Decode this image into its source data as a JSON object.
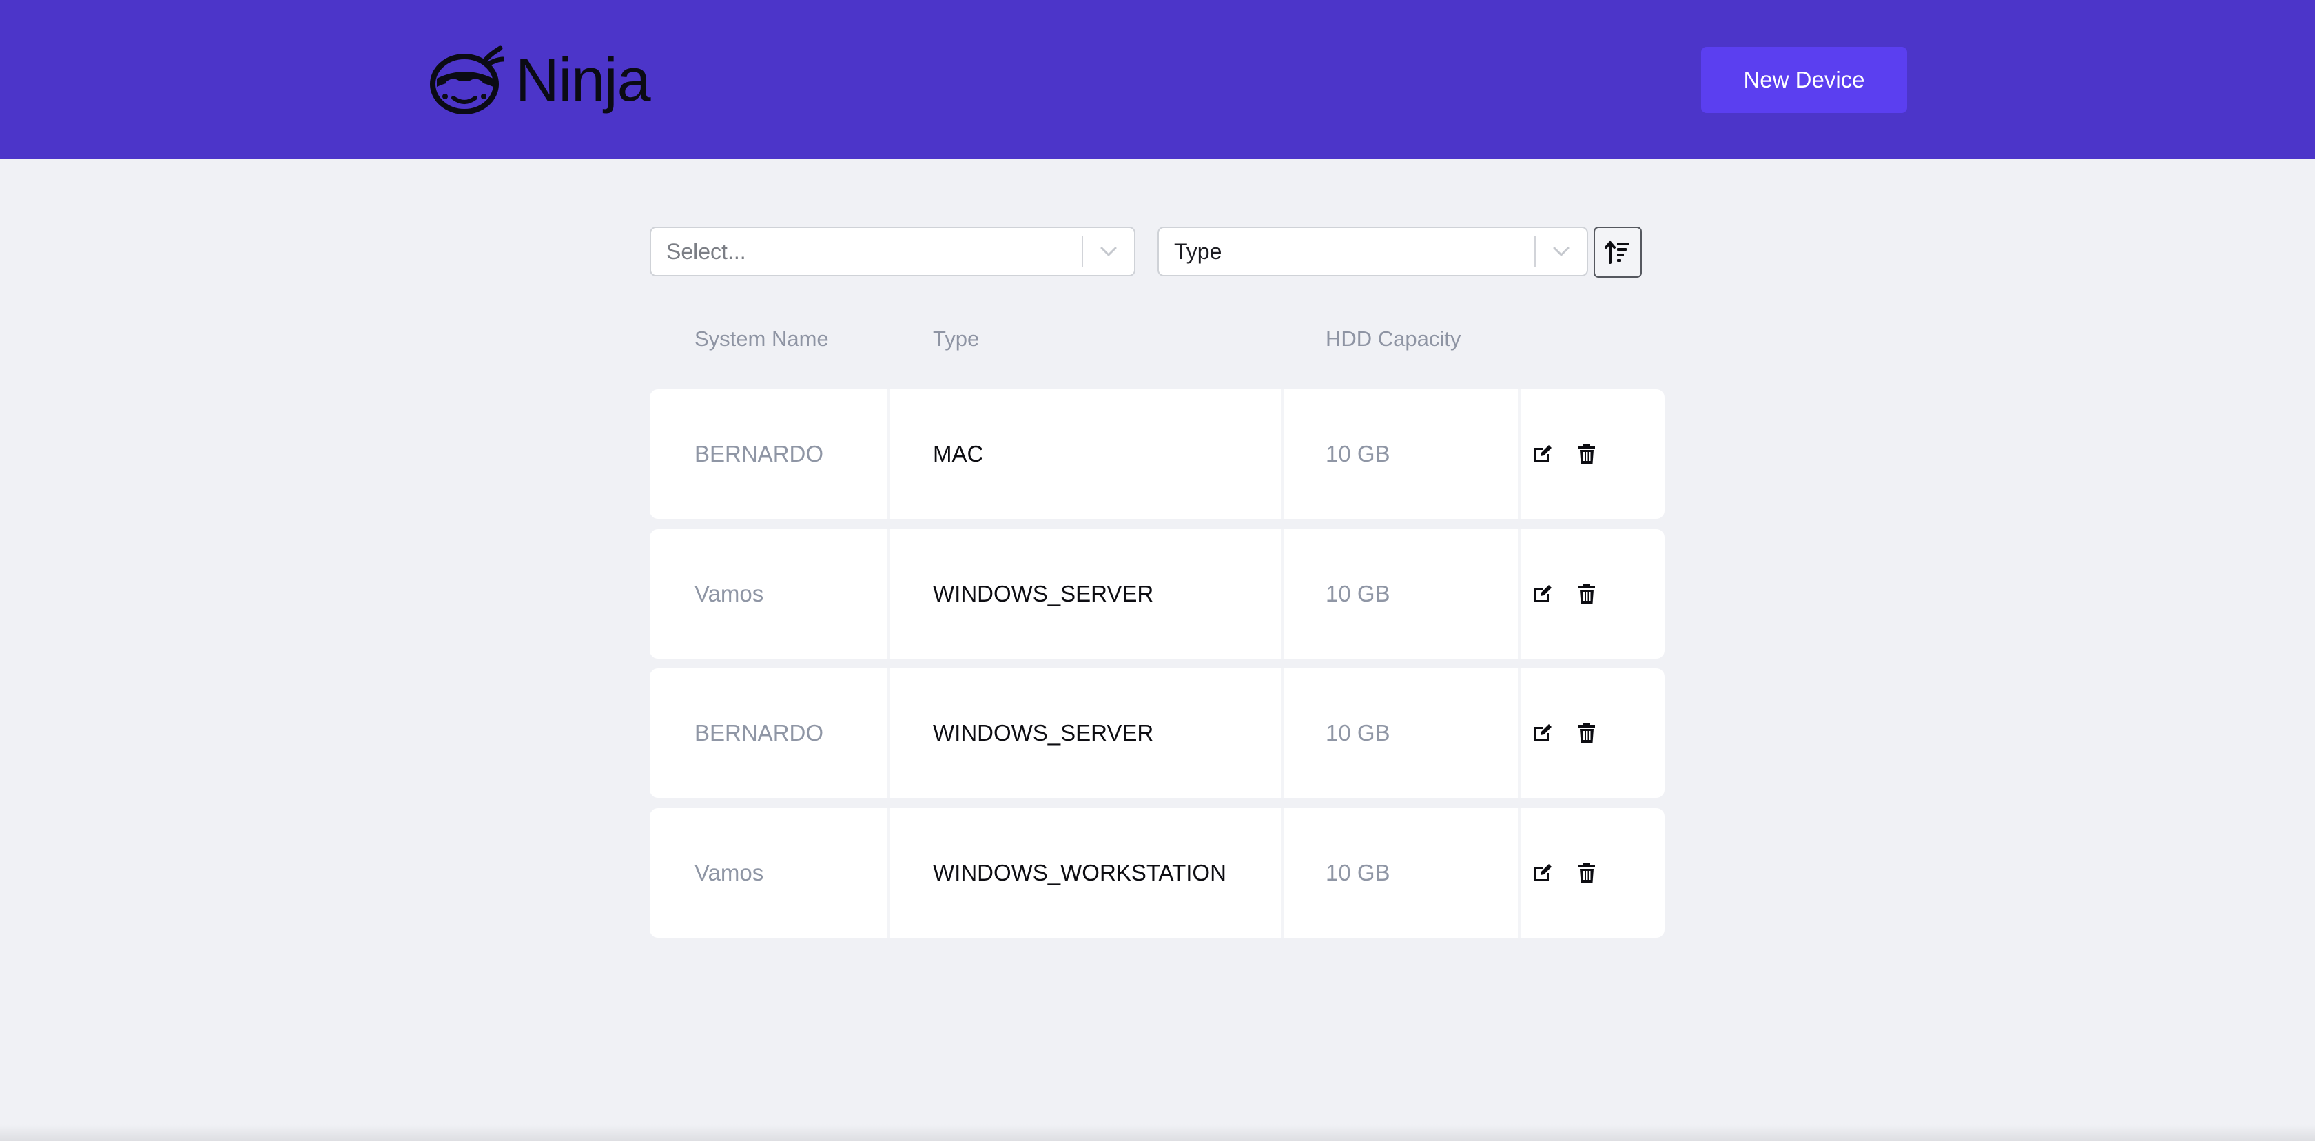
{
  "header": {
    "brand": "Ninja",
    "new_device_label": "New Device"
  },
  "filters": {
    "device_type_filter": {
      "placeholder": "Select...",
      "value": ""
    },
    "sort_by": {
      "value": "Type"
    }
  },
  "table": {
    "columns": [
      "System Name",
      "Type",
      "HDD Capacity"
    ],
    "rows": [
      {
        "system_name": "BERNARDO",
        "type": "MAC",
        "hdd_capacity": "10 GB"
      },
      {
        "system_name": "Vamos",
        "type": "WINDOWS_SERVER",
        "hdd_capacity": "10 GB"
      },
      {
        "system_name": "BERNARDO",
        "type": "WINDOWS_SERVER",
        "hdd_capacity": "10 GB"
      },
      {
        "system_name": "Vamos",
        "type": "WINDOWS_WORKSTATION",
        "hdd_capacity": "10 GB"
      }
    ]
  },
  "icons": {
    "logo": "ninja-face-icon",
    "sort": "sort-ascending-icon",
    "edit": "edit-icon",
    "delete": "trash-icon",
    "dropdown": "chevron-down-icon"
  },
  "colors": {
    "header_bg": "#4c35c9",
    "primary_button": "#5b3ff0",
    "page_bg": "#f0f1f5"
  }
}
